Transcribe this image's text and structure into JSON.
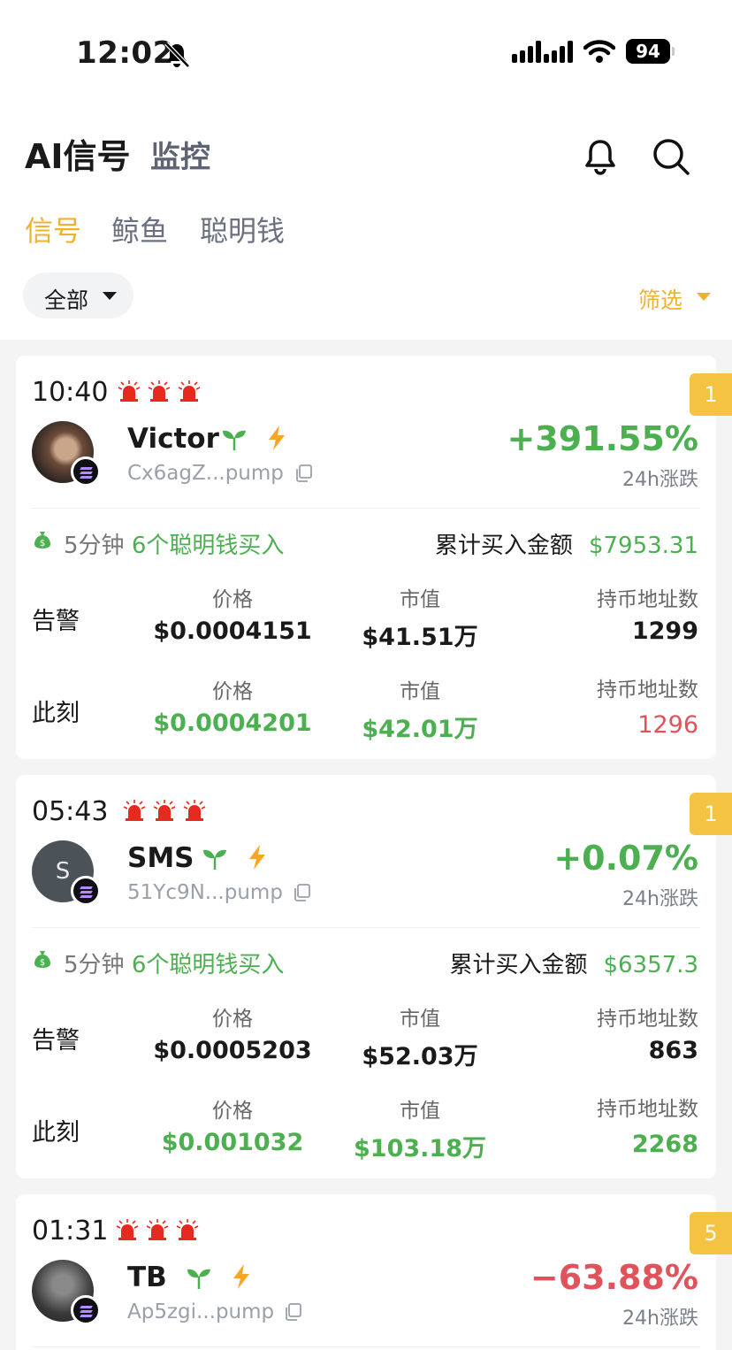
{
  "status_bar": {
    "time": "12:02",
    "battery": "94"
  },
  "header": {
    "title": "AI信号",
    "subtitle": "监控"
  },
  "tabs": [
    "信号",
    "鲸鱼",
    "聪明钱"
  ],
  "filter_chip": "全部",
  "filter_label": "筛选",
  "colors": {
    "accent": "#f0b22e",
    "up": "#4caf50",
    "down": "#e0535b"
  },
  "cards": [
    {
      "time": "10:40",
      "badge": "1",
      "name": "Victor",
      "address": "Cx6agZ...pump",
      "change": "+391.55%",
      "change_label": "24h涨跌",
      "window": "5分钟",
      "buyers": "6个聪明钱买入",
      "cum_label": "累计买入金额",
      "cum_value": "$7953.31",
      "alert_label": "告警",
      "now_label": "此刻",
      "price_label": "价格",
      "mcap_label": "市值",
      "holders_label": "持币地址数",
      "alert_price": "$0.0004151",
      "alert_mcap": "$41.51万",
      "alert_holders": "1299",
      "now_price": "$0.0004201",
      "now_mcap": "$42.01万",
      "now_holders": "1296"
    },
    {
      "time": "05:43",
      "badge": "1",
      "name": "SMS",
      "avatar_letter": "S",
      "address": "51Yc9N...pump",
      "change": "+0.07%",
      "change_label": "24h涨跌",
      "window": "5分钟",
      "buyers": "6个聪明钱买入",
      "cum_label": "累计买入金额",
      "cum_value": "$6357.3",
      "alert_label": "告警",
      "now_label": "此刻",
      "price_label": "价格",
      "mcap_label": "市值",
      "holders_label": "持币地址数",
      "alert_price": "$0.0005203",
      "alert_mcap": "$52.03万",
      "alert_holders": "863",
      "now_price": "$0.001032",
      "now_mcap": "$103.18万",
      "now_holders": "2268"
    },
    {
      "time": "01:31",
      "badge": "5",
      "name": "TB",
      "address": "Ap5zgi...pump",
      "change": "−63.88%",
      "change_label": "24h涨跌"
    }
  ]
}
